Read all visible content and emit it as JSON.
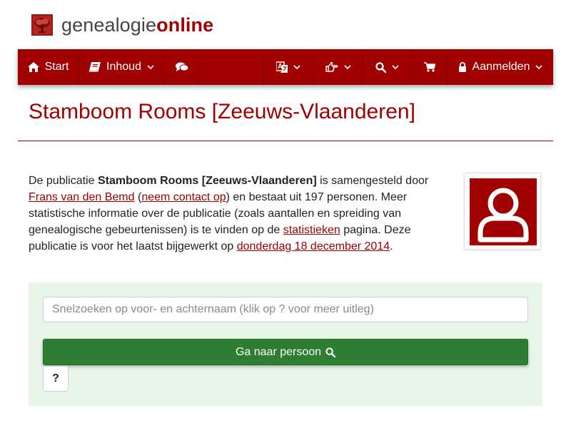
{
  "brand": {
    "part1": "genealogie",
    "part2": "online",
    "logo_icon": "tree-icon"
  },
  "nav": {
    "start_label": "Start",
    "inhoud_label": "Inhoud",
    "aanmelden_label": "Aanmelden",
    "icons": [
      "home-icon",
      "book-icon",
      "comments-icon",
      "language-icon",
      "hand-pointer-icon",
      "search-icon",
      "shopping-cart-icon",
      "lock-icon"
    ]
  },
  "page": {
    "title": "Stamboom Rooms [Zeeuws-Vlaanderen]"
  },
  "intro": {
    "t1": "De publicatie ",
    "pub_name": "Stamboom Rooms [Zeeuws-Vlaanderen]",
    "t2": " is samengesteld door ",
    "author_link": "Frans van den Bemd",
    "t3": " (",
    "contact_link": "neem contact op",
    "t4": ") en bestaat uit 197 personen. Meer statistische informatie over de publicatie (zoals aantallen en spreiding van genealogische gebeurtenissen) is te vinden op de ",
    "stats_link": "statistieken",
    "t5": " pagina. Deze publicatie is voor het laatst bijgewerkt op ",
    "date_link": "donderdag 18 december 2014",
    "t6": "."
  },
  "search": {
    "placeholder": "Snelzoeken op voor- en achternaam (klik op ? voor meer uitleg)",
    "value": "",
    "button_label": "Ga naar persoon",
    "help_label": "?"
  },
  "colors": {
    "brand": "#a00000",
    "button_green": "#2e7d32",
    "panel_bg": "#e8f5e9"
  }
}
